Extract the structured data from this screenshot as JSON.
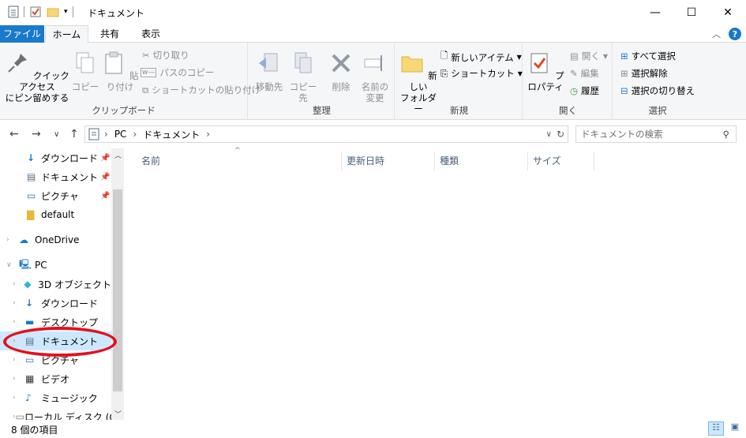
{
  "window": {
    "title": "ドキュメント",
    "controls": {
      "minimize": "—",
      "maximize": "☐",
      "close": "✕"
    }
  },
  "ribbon": {
    "tabs": [
      "ファイル",
      "ホーム",
      "共有",
      "表示"
    ],
    "clipboard": {
      "label": "クリップボード",
      "pin_quick_access": "クイック アクセス\nにピン留めする",
      "copy": "コピー",
      "paste": "貼り付け",
      "cut": "切り取り",
      "copy_path": "パスのコピー",
      "paste_shortcut": "ショートカットの貼り付け"
    },
    "organize": {
      "label": "整理",
      "move_to": "移動先",
      "copy_to": "コピー先",
      "delete": "削除",
      "rename_line1": "名前の",
      "rename_line2": "変更"
    },
    "new": {
      "label": "新規",
      "new_folder_line1": "新しい",
      "new_folder_line2": "フォルダー",
      "new_item": "新しいアイテム",
      "easy_access": "ショートカット"
    },
    "open": {
      "label": "開く",
      "properties": "プロパティ",
      "open": "開く",
      "edit": "編集",
      "history": "履歴"
    },
    "select": {
      "label": "選択",
      "select_all": "すべて選択",
      "select_none": "選択解除",
      "invert_selection": "選択の切り替え"
    }
  },
  "address": {
    "crumbs": [
      "PC",
      "ドキュメント"
    ],
    "search_placeholder": "ドキュメントの検索"
  },
  "nav_pane": {
    "items": [
      {
        "label": "ダウンロード",
        "icon": "download-arrow-icon",
        "pinned": true
      },
      {
        "label": "ドキュメント",
        "icon": "document-icon",
        "pinned": true
      },
      {
        "label": "ピクチャ",
        "icon": "pictures-icon",
        "pinned": true
      },
      {
        "label": "default",
        "icon": "folder-icon",
        "pinned": false
      },
      {
        "label": "OneDrive",
        "icon": "cloud-icon",
        "pinned": false
      },
      {
        "label": "PC",
        "icon": "computer-icon",
        "pinned": false
      },
      {
        "label": "3D オブジェクト",
        "icon": "cube-icon",
        "pinned": false
      },
      {
        "label": "ダウンロード",
        "icon": "download-arrow-icon",
        "pinned": false
      },
      {
        "label": "デスクトップ",
        "icon": "desktop-icon",
        "pinned": false
      },
      {
        "label": "ドキュメント",
        "icon": "document-icon",
        "pinned": false,
        "selected": true
      },
      {
        "label": "ピクチャ",
        "icon": "pictures-icon",
        "pinned": false
      },
      {
        "label": "ビデオ",
        "icon": "video-icon",
        "pinned": false
      },
      {
        "label": "ミュージック",
        "icon": "music-icon",
        "pinned": false
      },
      {
        "label": "ローカル ディスク (C",
        "icon": "drive-icon",
        "pinned": false
      }
    ]
  },
  "columns": [
    "名前",
    "更新日時",
    "種類",
    "サイズ"
  ],
  "status": {
    "item_count": "8 個の項目"
  },
  "colors": {
    "accent": "#1979ca",
    "selected": "#cce8ff",
    "annotation": "#e3111e"
  }
}
